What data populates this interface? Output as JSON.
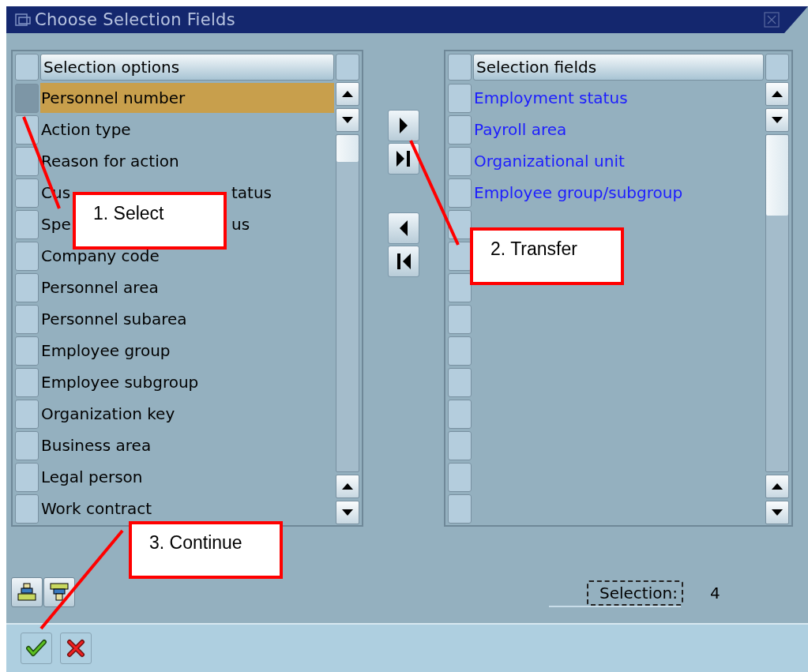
{
  "window": {
    "title": "Choose Selection Fields"
  },
  "options_table": {
    "header": "Selection options",
    "rows": [
      {
        "text": "Personnel number",
        "selected": true
      },
      {
        "text": "Action type",
        "selected": false
      },
      {
        "text": "Reason for action",
        "selected": false
      },
      {
        "text": "Cus",
        "tail": "tatus",
        "selected": false
      },
      {
        "text": "Spe",
        "tail": "us",
        "selected": false
      },
      {
        "text": "Company code",
        "selected": false
      },
      {
        "text": "Personnel area",
        "selected": false
      },
      {
        "text": "Personnel subarea",
        "selected": false
      },
      {
        "text": "Employee group",
        "selected": false
      },
      {
        "text": "Employee subgroup",
        "selected": false
      },
      {
        "text": "Organization key",
        "selected": false
      },
      {
        "text": "Business area",
        "selected": false
      },
      {
        "text": "Legal person",
        "selected": false
      },
      {
        "text": "Work contract",
        "selected": false
      }
    ]
  },
  "fields_table": {
    "header": "Selection fields",
    "rows": [
      {
        "text": "Employment status"
      },
      {
        "text": "Payroll area"
      },
      {
        "text": "Organizational unit"
      },
      {
        "text": "Employee group/subgroup"
      }
    ]
  },
  "selection": {
    "label": "Selection:",
    "value": "4"
  },
  "callouts": [
    {
      "text": "1. Select"
    },
    {
      "text": "2. Transfer"
    },
    {
      "text": "3. Continue"
    }
  ]
}
